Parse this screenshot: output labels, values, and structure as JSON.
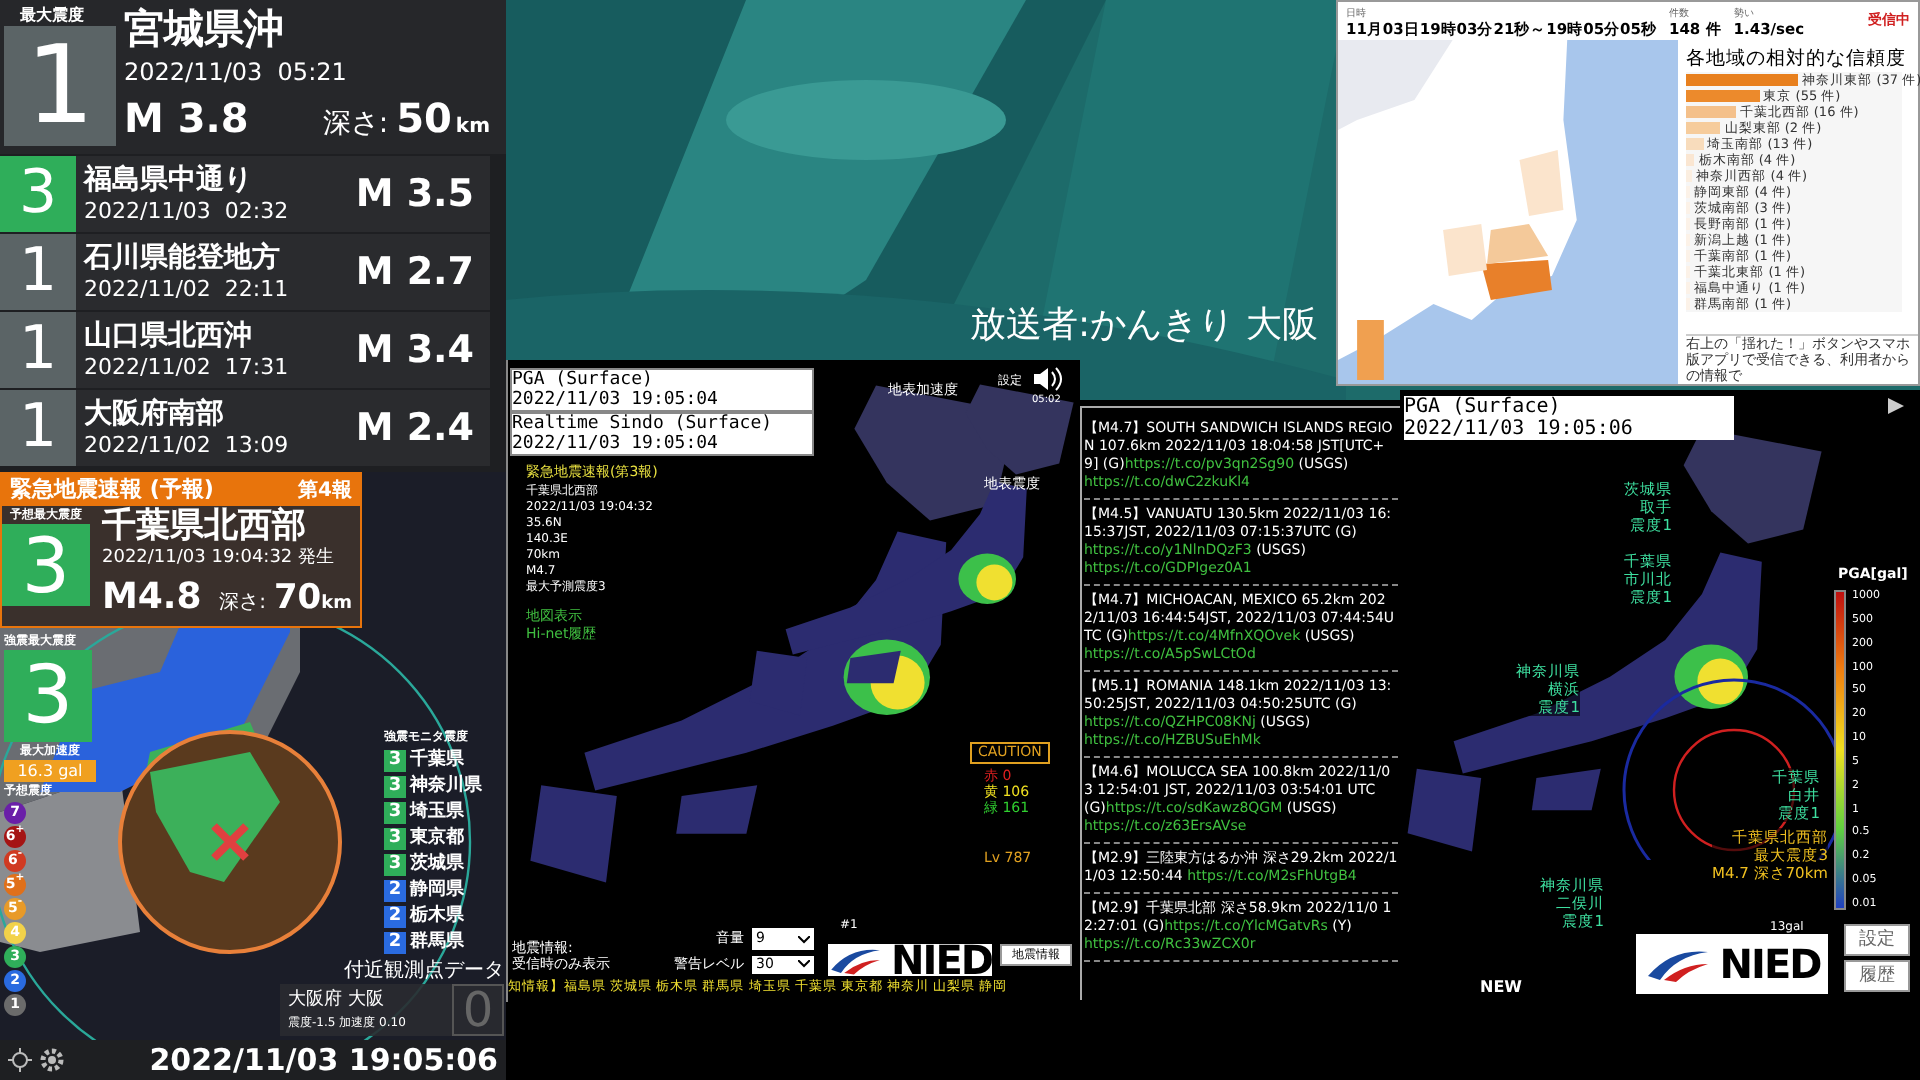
{
  "latest": {
    "label": "最大震度",
    "intensity": "1",
    "color": "#5b6466",
    "place": "宮城県沖",
    "time": "2022/11/03  05:21",
    "magnitude": "M 3.8",
    "depth_label": "深さ:",
    "depth": "50",
    "depth_unit": "km"
  },
  "history": [
    {
      "intensity": "3",
      "color": "#2fae5a",
      "place": "福島県中通り",
      "time": "2022/11/03  02:32",
      "magnitude": "M 3.5"
    },
    {
      "intensity": "1",
      "color": "#5b6466",
      "place": "石川県能登地方",
      "time": "2022/11/02  22:11",
      "magnitude": "M 2.7"
    },
    {
      "intensity": "1",
      "color": "#5b6466",
      "place": "山口県北西沖",
      "time": "2022/11/02  17:31",
      "magnitude": "M 3.4"
    },
    {
      "intensity": "1",
      "color": "#5b6466",
      "place": "大阪府南部",
      "time": "2022/11/02  13:09",
      "magnitude": "M 2.4"
    }
  ],
  "eew": {
    "title": "緊急地震速報 (予報)",
    "report": "第4報",
    "forecast_label": "予想最大震度",
    "forecast_intensity": "3",
    "color": "#2fae5a",
    "place": "千葉県北西部",
    "time": "2022/11/03 19:04:32 発生",
    "magnitude": "M4.8",
    "depth_label": "深さ:",
    "depth": "70",
    "depth_unit": "km"
  },
  "observed": {
    "label": "強震最大震度",
    "intensity": "3",
    "color": "#2fae5a",
    "pga_label": "最大加速度",
    "pga": "16.3 gal"
  },
  "legend": {
    "title": "予想震度",
    "items": [
      {
        "text": "7",
        "color": "#6a1fa8"
      },
      {
        "text": "6$^{+}$",
        "color": "#a51414"
      },
      {
        "text": "6$^{-}$",
        "color": "#d03a22"
      },
      {
        "text": "5$^{+}$",
        "color": "#e0701a"
      },
      {
        "text": "5$^{-}$",
        "color": "#e89a28"
      },
      {
        "text": "4",
        "color": "#f2d24a"
      },
      {
        "text": "3",
        "color": "#2fae5a"
      },
      {
        "text": "2",
        "color": "#2a6be0"
      },
      {
        "text": "1",
        "color": "#6b6b6b"
      }
    ]
  },
  "monitor": {
    "title": "強震モニタ震度",
    "items": [
      {
        "intensity": "3",
        "color": "#2fae5a",
        "place": "千葉県"
      },
      {
        "intensity": "3",
        "color": "#2fae5a",
        "place": "神奈川県"
      },
      {
        "intensity": "3",
        "color": "#2fae5a",
        "place": "埼玉県"
      },
      {
        "intensity": "3",
        "color": "#2fae5a",
        "place": "東京都"
      },
      {
        "intensity": "3",
        "color": "#2fae5a",
        "place": "茨城県"
      },
      {
        "intensity": "2",
        "color": "#2a6be0",
        "place": "静岡県"
      },
      {
        "intensity": "2",
        "color": "#2a6be0",
        "place": "栃木県"
      },
      {
        "intensity": "2",
        "color": "#2a6be0",
        "place": "群馬県"
      }
    ]
  },
  "station": {
    "title": "付近観測点データ",
    "name": "大阪府 大阪",
    "reading": "震度-1.5 加速度 0.10",
    "intensity": "0"
  },
  "clock": "2022/11/03 19:05:06",
  "stream": {
    "caption": "放送者:かんきり 大阪"
  },
  "kmoni": {
    "pga_title": "PGA (Surface)",
    "pga_time": "2022/11/03 19:05:04",
    "sindo_title": "Realtime Sindo (Surface)",
    "sindo_time": "2022/11/03 19:05:04",
    "eew_heading": "緊急地震速報(第3報)",
    "eew_lines": [
      "千葉県北西部",
      "2022/11/03 19:04:32",
      "35.6N",
      "140.3E",
      "70km",
      "M4.7",
      "最大予測震度3"
    ],
    "links": [
      "地図表示",
      "Hi-net履歴"
    ],
    "accel_label": "地表加速度",
    "sindo_label": "地表震度",
    "settings": "設定",
    "time": "05:02",
    "caution": "CAUTION",
    "counts": [
      {
        "text": "赤 0",
        "color": "#e02020"
      },
      {
        "text": "黄 106",
        "color": "#f0e020"
      },
      {
        "text": "緑 161",
        "color": "#30d030"
      }
    ],
    "level": "Lv 787",
    "volume_label": "音量",
    "volume": "9",
    "warn_label": "警告レベル",
    "warn": "30",
    "channel": "#1",
    "logo": "NIED",
    "button": "地震情報",
    "info_label": "地震情報:",
    "info_mode": "受信時のみ表示",
    "ticker": "知情報】福島県 茨城県 栃木県 群馬県 埼玉県 千葉県 東京都 神奈川 山梨県 静岡"
  },
  "tweets": [
    {
      "title": "【M4.7】SOUTH SANDWICH ISLANDS REGION 107.6km 2022/11/03 18:04:58 JST[UTC+9]",
      "links": [
        {
          "prefix": "(G)",
          "url": "https://t.co/pv3qn2Sg90"
        },
        {
          "prefix": "(USGS)",
          "url": "https://t.co/dwC2zkuKl4"
        }
      ]
    },
    {
      "title": "【M4.5】VANUATU 130.5km 2022/11/03 16:15:37JST, 2022/11/03 07:15:37UTC",
      "links": [
        {
          "prefix": "(G)",
          "url": "https://t.co/y1NlnDQzF3"
        },
        {
          "prefix": "(USGS)",
          "url": "https://t.co/GDPIgez0A1"
        }
      ]
    },
    {
      "title": "【M4.7】MICHOACAN, MEXICO 65.2km 2022/11/03 16:44:54JST, 2022/11/03 07:44:54UTC",
      "links": [
        {
          "prefix": "(G)",
          "url": "https://t.co/4MfnXQOvek"
        },
        {
          "prefix": "(USGS)",
          "url": "https://t.co/A5pSwLCtOd"
        }
      ]
    },
    {
      "title": "【M5.1】ROMANIA 148.1km 2022/11/03 13:50:25JST, 2022/11/03 04:50:25UTC",
      "links": [
        {
          "prefix": "(G)",
          "url": "https://t.co/QZHPC08KNj"
        },
        {
          "prefix": "(USGS)",
          "url": "https://t.co/HZBUSuEhMk"
        }
      ]
    },
    {
      "title": "【M4.6】MOLUCCA SEA 100.8km 2022/11/03 12:54:01 JST, 2022/11/03 03:54:01 UTC",
      "links": [
        {
          "prefix": "(G)",
          "url": "https://t.co/sdKawz8QGM"
        },
        {
          "prefix": "(USGS)",
          "url": "https://t.co/z63ErsAVse"
        }
      ]
    },
    {
      "title": "【M2.9】三陸東方はるか沖 深さ29.2km 2022/11/03 12:50:44",
      "links": [
        {
          "url": "https://t.co/M2sFhUtgB4"
        }
      ]
    },
    {
      "title": "【M2.9】千葉県北部 深さ58.9km 2022/11/0 12:27:01",
      "links": [
        {
          "prefix": "(G)",
          "url": "https://t.co/YlcMGatvRs"
        },
        {
          "prefix": "(Y)",
          "url": "https://t.co/Rc33wZCX0r"
        }
      ]
    }
  ],
  "yure": {
    "date_label": "日時",
    "date": "11月03日19時03分21秒～19時05分05秒",
    "count_label": "件数",
    "count": "148 件",
    "rate_label": "勢い",
    "rate": "1.43/sec",
    "status": "受信中",
    "title": "各地域の相対的な信頼度",
    "regions": [
      {
        "name": "神奈川東部 (37 件)",
        "level": 0.52,
        "color": "#e8801e"
      },
      {
        "name": "東京 (55 件)",
        "level": 0.34,
        "color": "#ec8a2c"
      },
      {
        "name": "千葉北西部 (16 件)",
        "level": 0.23,
        "color": "#f4c08a"
      },
      {
        "name": "山梨東部 (2 件)",
        "level": 0.16,
        "color": "#f6cc9c"
      },
      {
        "name": "埼玉南部 (13 件)",
        "level": 0.08,
        "color": "#f8dcbc"
      },
      {
        "name": "栃木南部 (4 件)",
        "level": 0.04,
        "color": "#fae6d2"
      },
      {
        "name": "神奈川西部 (4 件)",
        "level": 0.03,
        "color": "#fbeee0"
      },
      {
        "name": "静岡東部 (4 件)",
        "level": 0.02,
        "color": "#fcf2e8"
      },
      {
        "name": "茨城南部 (3 件)",
        "level": 0.02,
        "color": "#fcf2e8"
      },
      {
        "name": "長野南部 (1 件)",
        "level": 0.02,
        "color": "#fcf2e8"
      },
      {
        "name": "新潟上越 (1 件)",
        "level": 0.02,
        "color": "#fcf2e8"
      },
      {
        "name": "千葉南部 (1 件)",
        "level": 0.02,
        "color": "#fcf2e8"
      },
      {
        "name": "千葉北東部 (1 件)",
        "level": 0.02,
        "color": "#fcf2e8"
      },
      {
        "name": "福島中通り (1 件)",
        "level": 0.02,
        "color": "#fcf2e8"
      },
      {
        "name": "群馬南部 (1 件)",
        "level": 0.02,
        "color": "#fcf2e8"
      }
    ],
    "note": "右上の「揺れた！」ボタンやスマホ版アプリで受信できる、利用者からの情報で"
  },
  "pga": {
    "title": "PGA (Surface)",
    "time": "2022/11/03 19:05:06",
    "callouts": [
      {
        "lines": [
          "茨城県",
          "取手",
          "震度1"
        ],
        "color": "#3ee0a0"
      },
      {
        "lines": [
          "千葉県",
          "市川北",
          "震度1"
        ],
        "color": "#3ee0a0"
      },
      {
        "lines": [
          "神奈川県",
          "横浜",
          "震度1"
        ],
        "color": "#3ee0a0"
      },
      {
        "lines": [
          "千葉県",
          "白井",
          "震度1"
        ],
        "color": "#3ee0a0"
      },
      {
        "lines": [
          "千葉県北西部",
          "最大震度3",
          "M4.7 深さ70km"
        ],
        "color": "#f0c020"
      },
      {
        "lines": [
          "神奈川県",
          "二俣川",
          "震度1"
        ],
        "color": "#3ee0a0"
      }
    ],
    "scale_title": "PGA[gal]",
    "ticks": [
      "1000",
      "500",
      "200",
      "100",
      "50",
      "20",
      "10",
      "5",
      "2",
      "1",
      "0.5",
      "0.2",
      "0.05",
      "0.01"
    ],
    "peak": "13gal",
    "new": "NEW",
    "logo": "NIED",
    "buttons": [
      "設定",
      "履歴"
    ]
  }
}
